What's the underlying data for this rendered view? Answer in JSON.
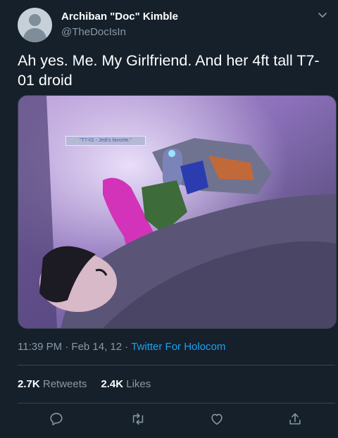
{
  "tweet": {
    "author_name": "Archiban \"Doc\" Kimble",
    "author_handle": "@TheDocIsIn",
    "text": "Ah yes. Me. My Girlfriend. And her 4ft tall T7-01 droid",
    "image_caption": "\"T7-01 - Jedi's favorite.\"",
    "timestamp": "11:39 PM · Feb 14, 12 · ",
    "source": "Twitter For Holocom",
    "retweets_count": "2.7K",
    "retweets_label": "Retweets",
    "likes_count": "2.4K",
    "likes_label": "Likes"
  },
  "icons": {
    "more": "chevron-down-icon",
    "reply": "reply-icon",
    "retweet": "retweet-icon",
    "like": "heart-icon",
    "share": "share-icon"
  },
  "colors": {
    "background": "#15202b",
    "secondary_text": "#8899a6",
    "link": "#1da1f2",
    "divider": "#38444d"
  }
}
